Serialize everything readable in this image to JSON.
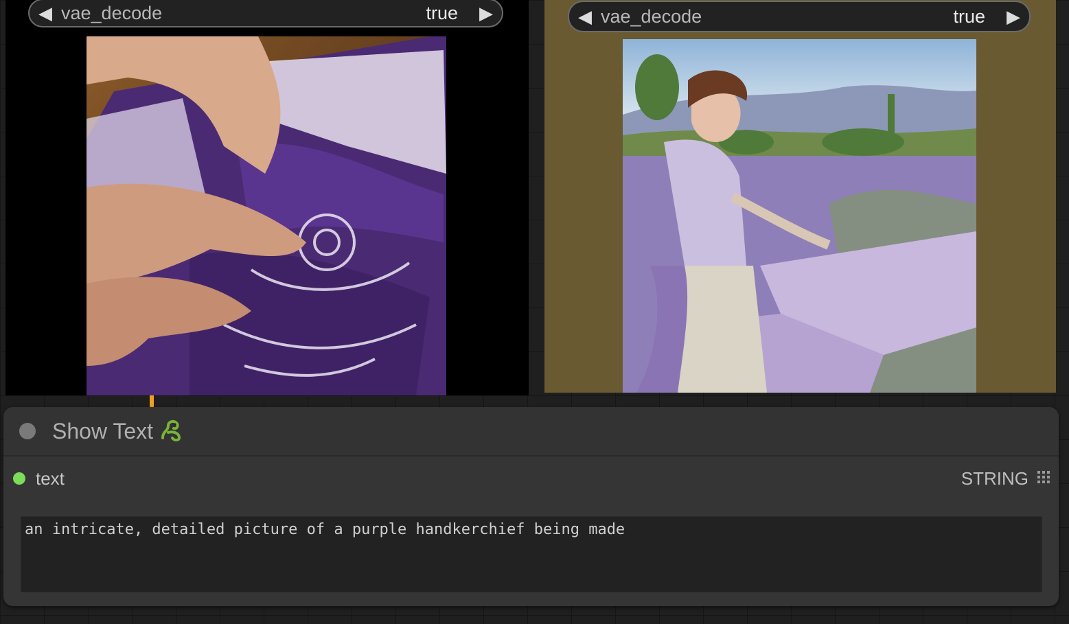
{
  "panels": {
    "left": {
      "combo_label": "vae_decode",
      "combo_value": "true"
    },
    "right": {
      "combo_label": "vae_decode",
      "combo_value": "true"
    }
  },
  "show_text_node": {
    "title": "Show Text",
    "output_name": "text",
    "output_type": "STRING",
    "text_value": "an intricate, detailed picture of a purple handkerchief being made"
  },
  "colors": {
    "canvas_bg": "#1f1f1f",
    "node_bg": "#353535",
    "output_dot": "#7ddc5a",
    "wire": "#f0a020",
    "right_panel_bg": "#6a5a32"
  },
  "icons": {
    "combo_prev": "triangle-left-icon",
    "combo_next": "triangle-right-icon",
    "title_badge": "snake-icon",
    "output_type": "grid-dots-icon"
  }
}
